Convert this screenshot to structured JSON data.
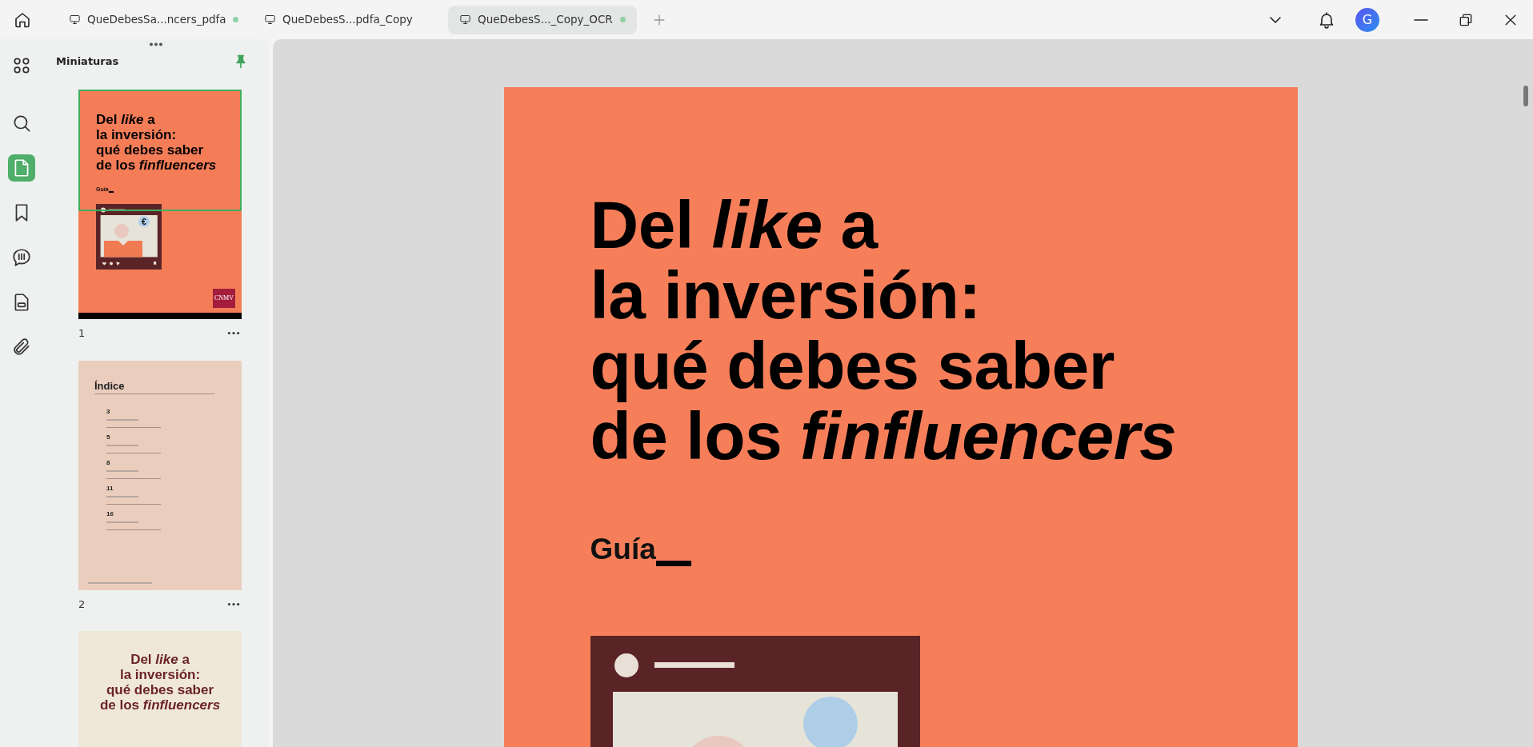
{
  "tabs": [
    {
      "label": "QueDebesSa...ncers_pdfa",
      "selected": false,
      "modified": true
    },
    {
      "label": "QueDebesS...pdfa_Copy",
      "selected": false,
      "modified": false
    },
    {
      "label": "QueDebesS..._Copy_OCR",
      "selected": true,
      "modified": true
    }
  ],
  "user": {
    "initial": "G"
  },
  "tools": [
    {
      "kind": "apps",
      "selected": false
    },
    {
      "kind": "search",
      "selected": false
    },
    {
      "kind": "pages",
      "selected": true
    },
    {
      "kind": "bookmark",
      "selected": false
    },
    {
      "kind": "comments",
      "selected": false
    },
    {
      "kind": "form",
      "selected": false
    },
    {
      "kind": "attachment",
      "selected": false
    }
  ],
  "panel": {
    "title": "Miniaturas",
    "pinned": true
  },
  "thumbnails": [
    {
      "kind": "cover",
      "number": "1",
      "selected": true,
      "title_lines": [
        "Del *like* a",
        "la inversión:",
        "qué debes saber",
        "de los *finfluencers*"
      ],
      "subtitle": "Guía",
      "coin_symbol": "€",
      "logo": "CNMV"
    },
    {
      "kind": "index",
      "number": "2",
      "selected": false,
      "heading": "Índice",
      "entries": [
        "3",
        "5",
        "8",
        "11",
        "16"
      ]
    },
    {
      "kind": "cover-light",
      "selected": false,
      "title_lines": [
        "Del *like* a",
        "la inversión:",
        "qué debes saber",
        "de los *finfluencers*"
      ]
    }
  ],
  "page": {
    "title_lines": [
      "Del *like* a",
      "la inversión:",
      "qué debes saber",
      "de los *finfluencers*"
    ],
    "subtitle": "Guía"
  }
}
